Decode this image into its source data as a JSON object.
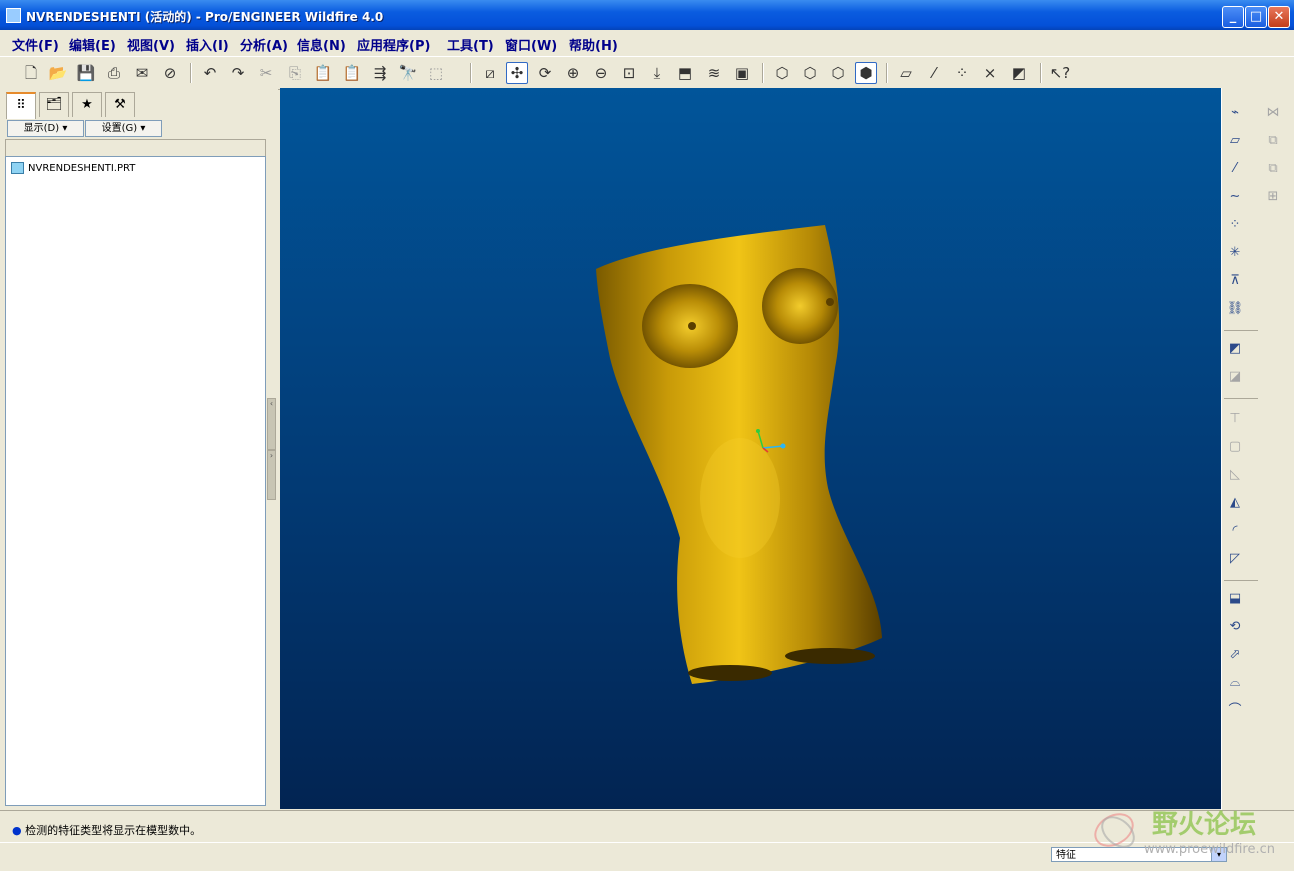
{
  "window": {
    "title": "NVRENDESHENTI (活动的) - Pro/ENGINEER Wildfire 4.0",
    "minimize": "_",
    "maximize": "□",
    "close": "✕"
  },
  "menu": [
    "文件(F)",
    "编辑(E)",
    "视图(V)",
    "插入(I)",
    "分析(A)",
    "信息(N)",
    "应用程序(P)",
    "工具(T)",
    "窗口(W)",
    "帮助(H)"
  ],
  "toolbar_icons": [
    "new-icon",
    "open-icon",
    "save-icon",
    "print-icon",
    "email-icon",
    "email-attach-icon",
    "undo-icon",
    "redo-icon",
    "cut-icon",
    "copy-icon",
    "paste-icon",
    "paste-special-icon",
    "regenerate-icon",
    "find-icon",
    "select-box-icon",
    "redraw-icon",
    "spin-center-icon",
    "orient-mode-icon",
    "zoom-in-icon",
    "zoom-out-icon",
    "refit-icon",
    "reorient-icon",
    "saved-views-icon",
    "layers-icon",
    "view-manager-icon",
    "wireframe-icon",
    "hidden-line-icon",
    "no-hidden-icon",
    "shading-icon",
    "datum-planes-icon",
    "datum-axes-icon",
    "datum-points-icon",
    "coordinate-systems-icon",
    "annotations-icon",
    "context-help-icon"
  ],
  "left_panel": {
    "tabs": [
      "model-tree-tab",
      "folder-browser-tab",
      "favorites-tab",
      "connections-tab"
    ],
    "show_dropdown": "显示(D)",
    "settings_dropdown": "设置(G)",
    "tree_items": [
      "NVRENDESHENTI.PRT"
    ]
  },
  "status": {
    "message": "检测的特征类型将显示在模型数中。"
  },
  "filter": {
    "value": "特征"
  },
  "watermark": {
    "text": "野火论坛",
    "url": "www.proewildfire.cn"
  },
  "colors": {
    "viewport_top": "#01559a",
    "viewport_bottom": "#022452",
    "model_gold": "#d4a40a",
    "menu_text": "#00008b"
  }
}
